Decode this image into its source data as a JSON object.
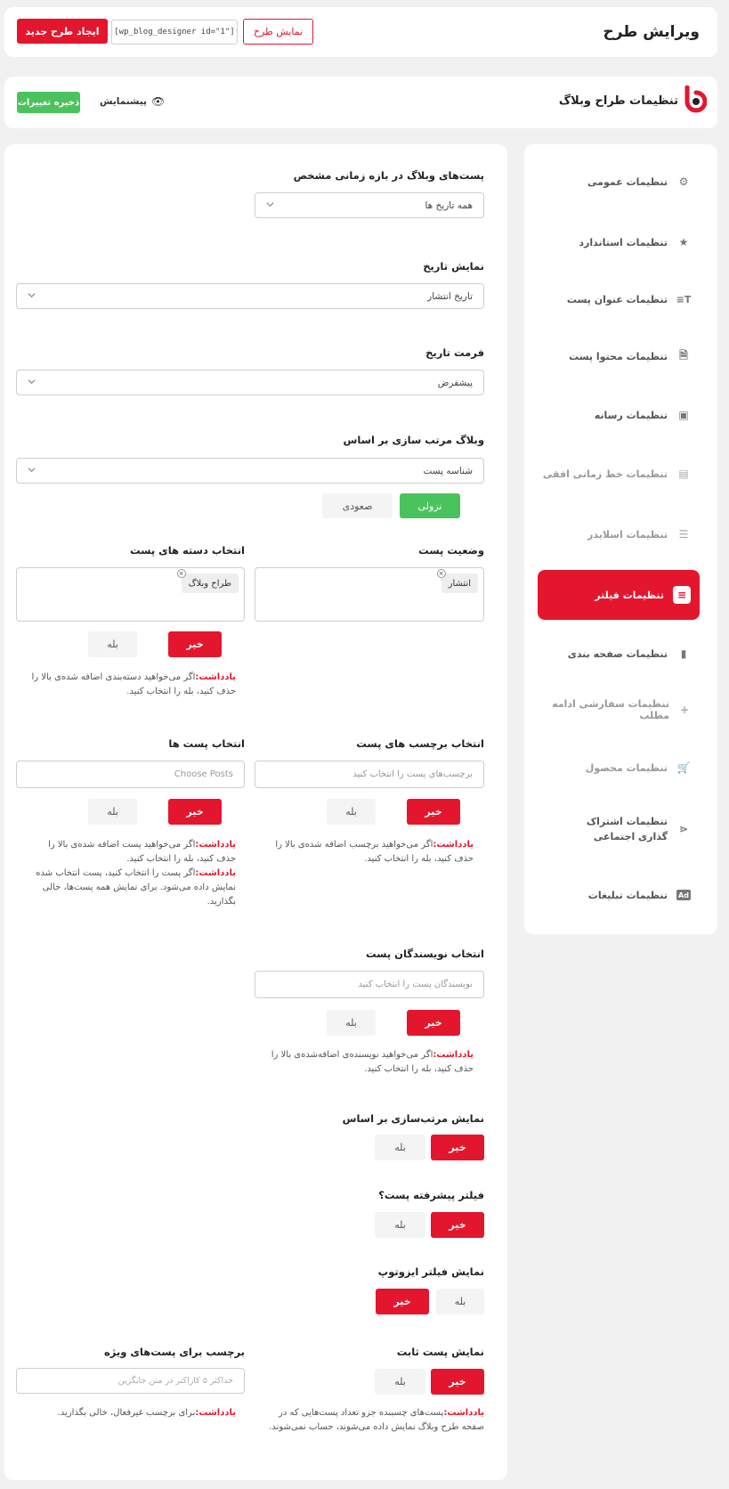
{
  "header": {
    "title": "ویرایش طرح",
    "show_button": "نمایش طرح",
    "shortcode": "[wp_blog_designer id=\"1\"]",
    "create_button": "ایجاد طرح جدید"
  },
  "toolbar": {
    "title": "تنظیمات طراح وبلاگ",
    "preview": "پیشنمایش",
    "save": "ذخیره تغییرات"
  },
  "sidebar": {
    "items": [
      {
        "label": "تنظیمات عمومی",
        "icon": "gear-icon"
      },
      {
        "label": "تنظیمات استاندارد",
        "icon": "star-settings-icon"
      },
      {
        "label": "تنظیمات عنوان پست",
        "icon": "text-title-icon"
      },
      {
        "label": "تنظیمات محتوا پست",
        "icon": "file-add-icon"
      },
      {
        "label": "تنظیمات رسانه",
        "icon": "image-icon"
      },
      {
        "label": "تنظیمات خط زمانی افقی",
        "icon": "timeline-icon"
      },
      {
        "label": "تنظیمات اسلایدر",
        "icon": "sliders-icon"
      },
      {
        "label": "تنظیمات فیلتر",
        "icon": "filter-icon"
      },
      {
        "label": "تنظیمات صفحه بندی",
        "icon": "pagination-icon"
      },
      {
        "label": "تنظیمات سفارشی ادامه مطلب",
        "icon": "plus-icon"
      },
      {
        "label": "تنظیمات محصول",
        "icon": "cart-icon"
      },
      {
        "label": "تنظیمات اشتراک گذاری اجتماعی",
        "icon": "share-icon"
      },
      {
        "label": "تنظیمات تبلیغات",
        "icon": "ad-icon"
      }
    ]
  },
  "form": {
    "date_range": {
      "label": "پست‌های وبلاگ در بازه زمانی مشخص",
      "value": "همه تاریخ ها"
    },
    "date_display": {
      "label": "نمایش تاریخ",
      "value": "تاریخ انتشار"
    },
    "date_format": {
      "label": "فرمت تاریخ",
      "value": "پیشفرض"
    },
    "order_by": {
      "label": "وبلاگ مرتب سازی بر اساس",
      "value": "شناسه پست",
      "desc": "نزولی",
      "asc": "صعودی"
    },
    "post_status": {
      "label": "وضعیت پست",
      "tag": "انتشار"
    },
    "categories": {
      "label": "انتخاب دسته های پست",
      "tag": "طراح وبلاگ",
      "yes": "بله",
      "no": "خیر",
      "note_label": "یادداشت:",
      "note": "اگر می‌خواهید دسته‌بندی اضافه شده‌ی بالا را حذف کنید، بله را انتخاب کنید."
    },
    "tags": {
      "label": "انتخاب برچسب های پست",
      "placeholder": "برچسب‌های پست را انتخاب کنید",
      "yes": "بله",
      "no": "خیر",
      "note_label": "یادداشت:",
      "note": "اگر می‌خواهید برچسب اضافه شده‌ی بالا را حذف کنید، بله را انتخاب کنید."
    },
    "posts": {
      "label": "انتخاب پست ها",
      "placeholder": "Choose Posts",
      "yes": "بله",
      "no": "خیر",
      "note_label": "یادداشت:",
      "note": "اگر می‌خواهید پست اضافه شده‌ی بالا را حذف کنید، بله را انتخاب کنید.",
      "note2_label": "یادداشت:",
      "note2": "اگر پست را انتخاب کنید، پست انتخاب شده نمایش داده می‌شود. برای نمایش همه پست‌ها، خالی بگذارید."
    },
    "authors": {
      "label": "انتخاب نویسندگان پست",
      "placeholder": "نویسندگان پست را انتخاب کنید",
      "yes": "بله",
      "no": "خیر",
      "note_label": "یادداشت:",
      "note": "اگر می‌خواهید نویسنده‌ی اضافه‌شده‌ی بالا را حذف کنید، بله را انتخاب کنید."
    },
    "show_sort": {
      "label": "نمایش مرتب‌سازی بر اساس",
      "yes": "بله",
      "no": "خیر"
    },
    "advanced_filter": {
      "label": "فیلتر پیشرفته پست؟",
      "yes": "بله",
      "no": "خیر"
    },
    "isotope_filter": {
      "label": "نمایش فیلتر ایزوتوپ",
      "yes": "بله",
      "no": "خیر"
    },
    "sticky_post": {
      "label": "نمایش پست ثابت",
      "yes": "بله",
      "no": "خیر",
      "note_label": "یادداشت:",
      "note": "پست‌های چسبنده جزو تعداد پست‌هایی که در صفحه طرح وبلاگ نمایش داده می‌شوند، حساب نمی‌شوند."
    },
    "featured_label": {
      "label": "برچسب برای پست‌های ویژه",
      "placeholder": "حداکثر ۵ کاراکتر در متن جایگزین",
      "note_label": "یادداشت:",
      "note": "برای برچسب غیرفعال، خالی بگذارید."
    }
  },
  "colors": {
    "accent": "#e3162e",
    "green": "#4bc35c"
  }
}
